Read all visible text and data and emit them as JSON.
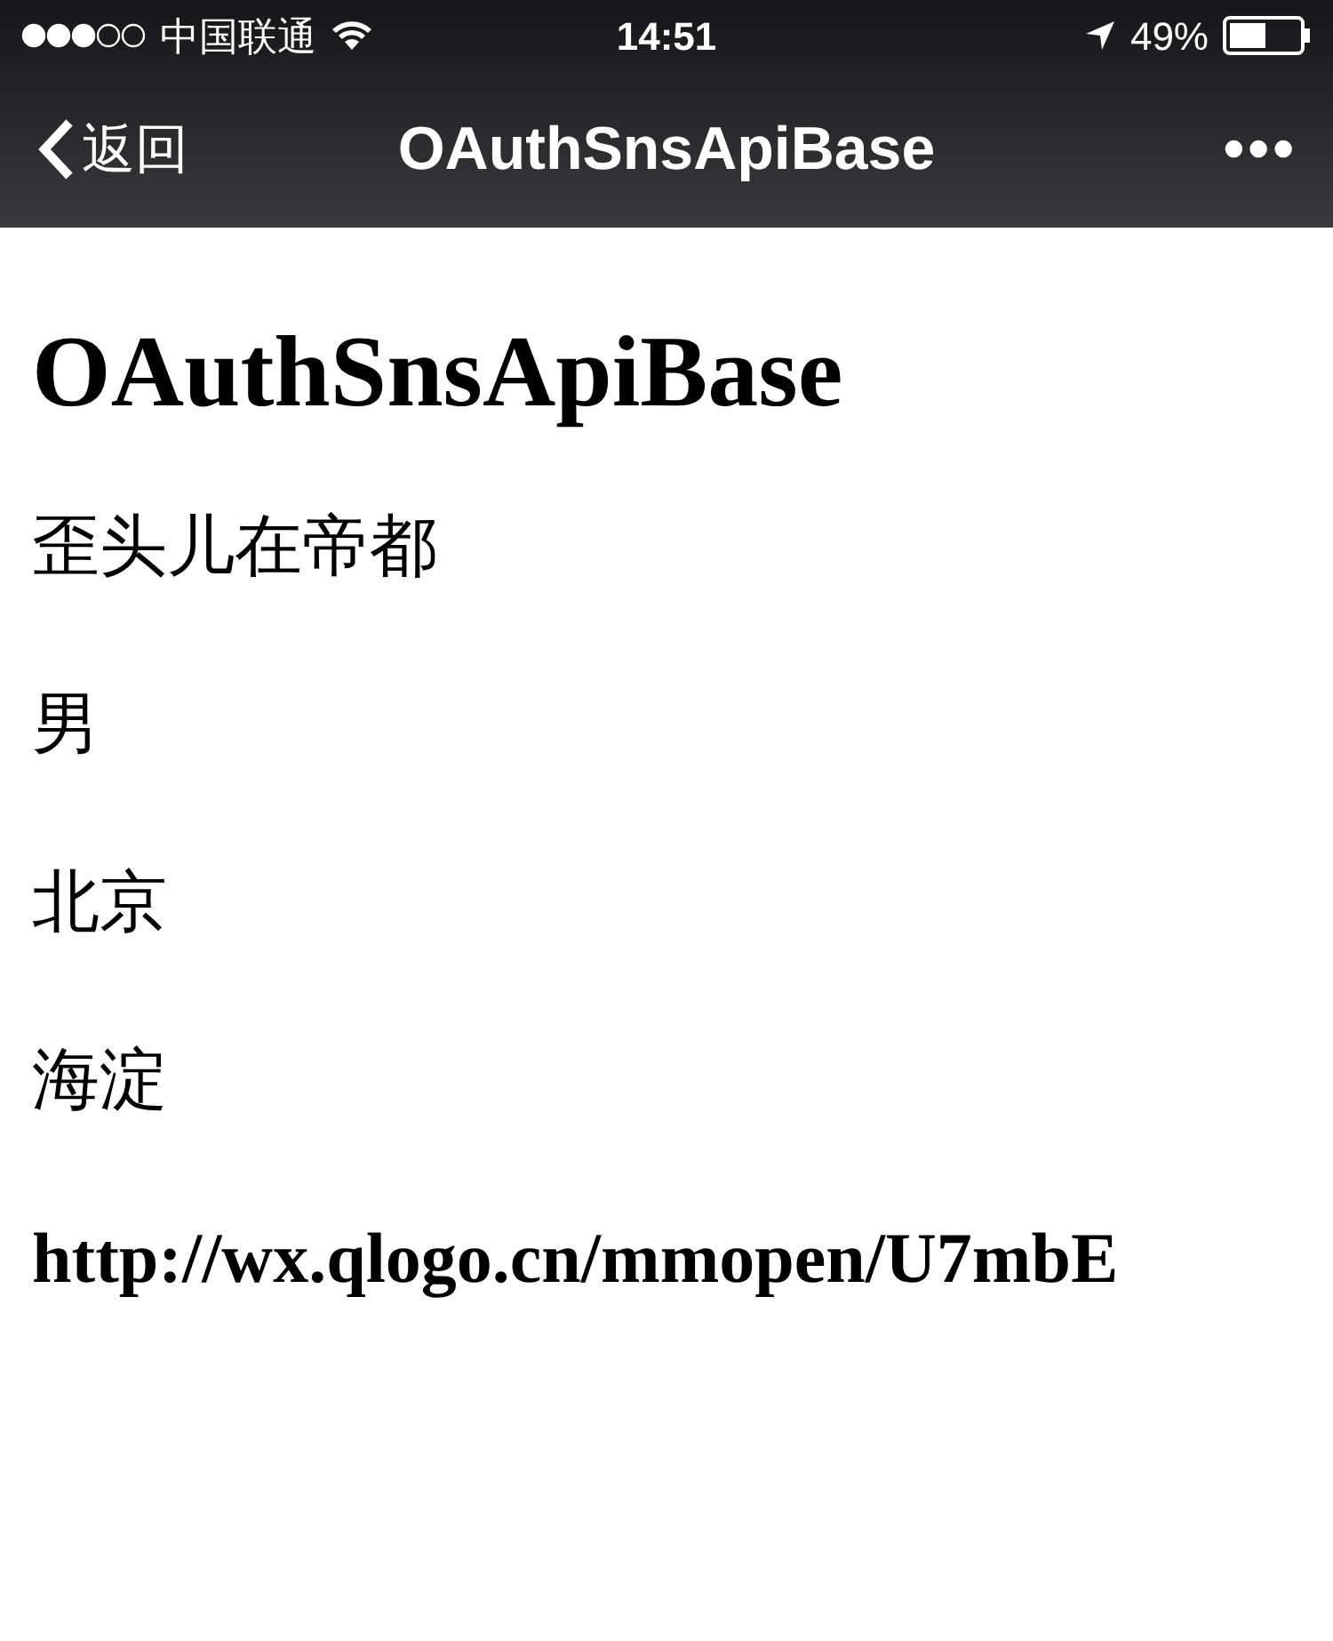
{
  "status_bar": {
    "carrier": "中国联通",
    "time": "14:51",
    "battery": "49%"
  },
  "nav_bar": {
    "back": "返回",
    "title": "OAuthSnsApiBase",
    "more": "•••"
  },
  "content": {
    "heading": "OAuthSnsApiBase",
    "lines": [
      {
        "kind": "text",
        "text": "歪头儿在帝都"
      },
      {
        "kind": "text",
        "text": "男"
      },
      {
        "kind": "text",
        "text": "北京"
      },
      {
        "kind": "text",
        "text": "海淀"
      },
      {
        "kind": "url",
        "text": "http://wx.qlogo.cn/mmopen/U7mbE"
      }
    ]
  }
}
